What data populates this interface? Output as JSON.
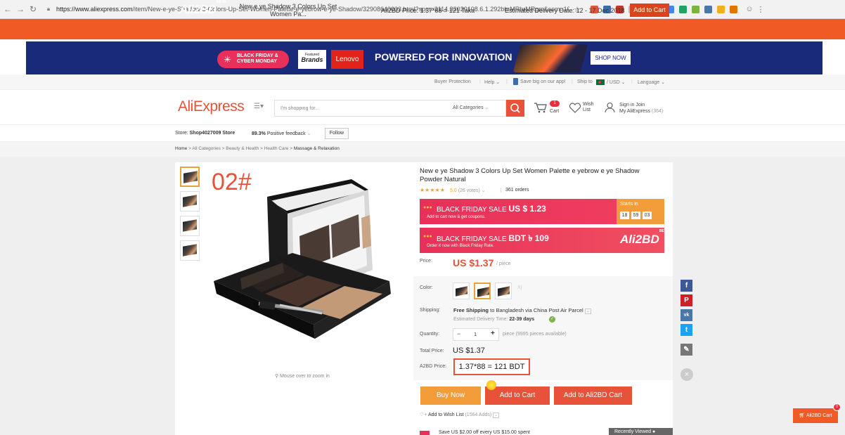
{
  "browser": {
    "url_host": "https://www.aliexpress.com",
    "url_path": "/item/New-e-ye-Shadow-3-Colors-Up-Set-Women-Palette-e-yebrow-e-ye-Shadow/32908640003.html?spm=2114.33020108.6.1.292bhrMRhrMRgm&scm=1007.17258.114352.0&pvid=8096abea..."
  },
  "ali2bd_bar": {
    "logo": "Ali2BD",
    "logo_tag": "BETA",
    "title": "New e ye Shadow 3 Colors Up Set Women Pa...",
    "price": "Ali2BD Price: 1.37*88 = 121 Taka",
    "delivery": "Estimated Delivery Date: 12 - 17 Dec 2018",
    "add_to_cart": "Add to Cart"
  },
  "banner": {
    "badge_line1": "BLACK FRIDAY &",
    "badge_line2": "CYBER MONDAY",
    "featured_small": "Featured",
    "featured_big": "Brands",
    "lenovo": "Lenovo",
    "headline": "POWERED FOR INNOVATION",
    "shop_now": "SHOP NOW"
  },
  "top_links": {
    "buyer_protection": "Buyer Protection",
    "help": "Help",
    "app": "Save big on our app!",
    "ship_to": "Ship to",
    "currency": "/ USD",
    "language": "Language"
  },
  "header": {
    "logo": "AliExpress",
    "search_placeholder": "I'm shopping for...",
    "category": "All Categories",
    "cart_count": "1",
    "cart_label": "Cart",
    "wish_line1": "Wish",
    "wish_line2": "List",
    "signin_line1": "Sign in  Join",
    "signin_line2": "My AliExpress",
    "signin_count": "(364)"
  },
  "store": {
    "label": "Store:",
    "name": "Shop4027009 Store",
    "feedback_pct": "89.3%",
    "feedback_label": "Positive feedback",
    "follow": "Follow"
  },
  "breadcrumb": {
    "home": "Home",
    "all": "All Categories",
    "beauty": "Beauty & Health",
    "health": "Health Care",
    "current": "Massage & Relaxation"
  },
  "gallery": {
    "variant_label": "02#",
    "zoom_hint": "Mouse over to zoom in"
  },
  "product": {
    "title": "New e ye Shadow 3 Colors Up Set Women Palette e yebrow e ye Shadow Powder Natural",
    "stars": "★★★★★",
    "rating": "5.0",
    "votes": "(26 votes)",
    "orders": "361 orders",
    "sale1_prefix": "BLACK FRIDAY SALE",
    "sale1_price": "US $ 1.23",
    "sale1_sub": "Add to cart now & get coupons.",
    "starts_in": "Starts in",
    "timer_h": "18",
    "timer_m": "59",
    "timer_s": "03",
    "sale2_prefix": "BLACK FRIDAY SALE",
    "sale2_price": "BDT ৳ 109",
    "sale2_sub": "Order it now with Black Friday Rate.",
    "sale2_logo": "Ali2BD",
    "sale2_logo_tag": "BETA",
    "price_label": "Price:",
    "price": "US $1.37",
    "price_unit": "/ piece",
    "color_label": "Color:",
    "shipping_label": "Shipping:",
    "shipping_free": "Free Shipping",
    "shipping_rest": "to Bangladesh via China Post Air Parcel",
    "delivery_label": "Estimated Delivery Time:",
    "delivery_days": "22-39 days",
    "quantity_label": "Quantity:",
    "quantity_value": "1",
    "quantity_avail": "piece (9995 pieces available)",
    "total_label": "Total Price:",
    "total": "US $1.37",
    "a2bd_label": "A2BD Price:",
    "a2bd_price": "1.37*88 = 121 BDT",
    "buy_now": "Buy Now",
    "add_to_cart": "Add to Cart",
    "add_to_a2bd": "Add to Ali2BD Cart",
    "wish_add": "Add to Wish List",
    "wish_count": "(1564 Adds)",
    "coupon": "Save US $2.00 off every US $15.00 spent",
    "recently_viewed": "Recently Viewed"
  },
  "floating_cart": {
    "label": "Ali2BD Cart",
    "count": "0"
  },
  "colors": {
    "accent": "#e8523a",
    "ali2bd": "#f05a25",
    "sale_pink": "#e8305a",
    "buy_now": "#f39c3a"
  }
}
